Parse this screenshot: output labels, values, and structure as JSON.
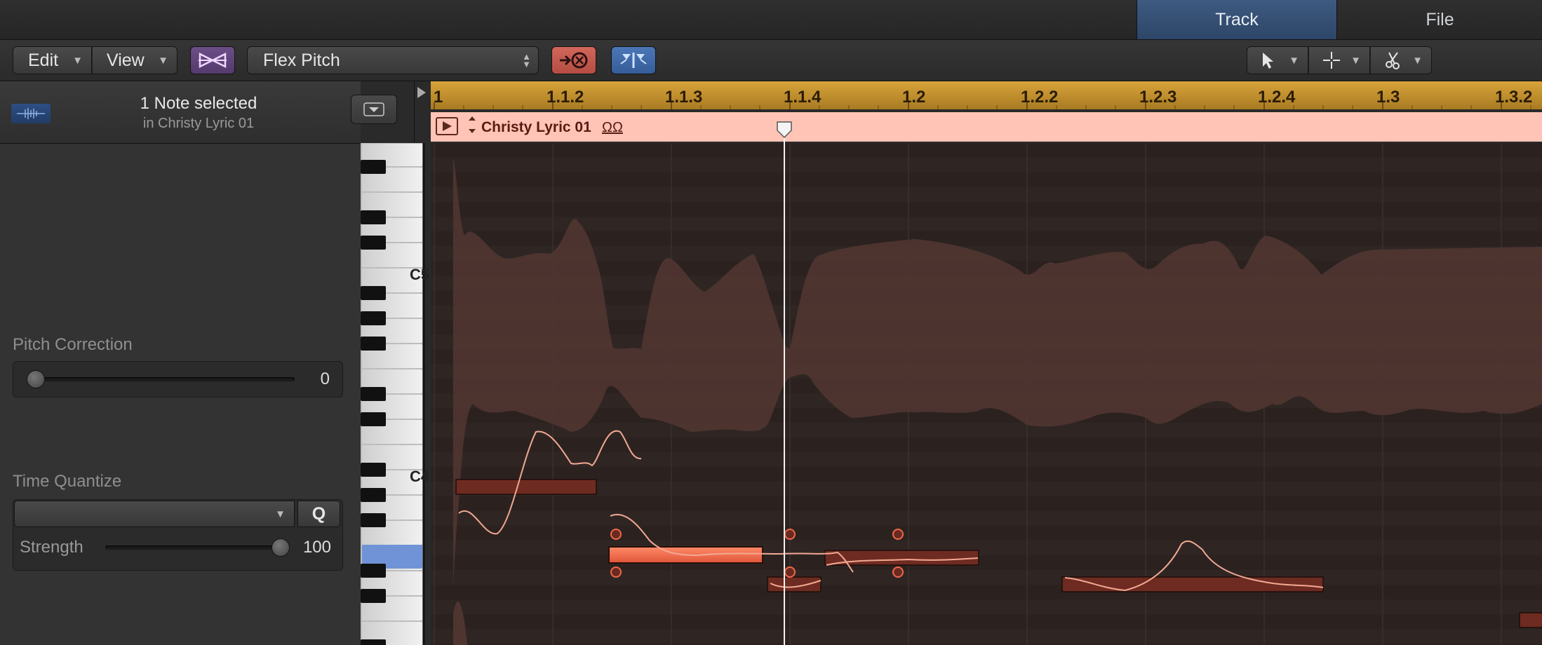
{
  "tabs": {
    "track": "Track",
    "file": "File"
  },
  "toolbar": {
    "edit": "Edit",
    "view": "View",
    "flex_mode": "Flex Pitch"
  },
  "inspector": {
    "selection_title": "1 Note selected",
    "selection_sub": "in Christy Lyric 01",
    "pitch_correction": {
      "label": "Pitch Correction",
      "value": "0"
    },
    "time_quantize": {
      "label": "Time Quantize",
      "selected": "",
      "q_button": "Q"
    },
    "strength": {
      "label": "Strength",
      "value": "100",
      "level": 1.0
    }
  },
  "keyboard": {
    "labels": [
      "C5",
      "C4"
    ]
  },
  "ruler": {
    "marks": [
      "1",
      "1.1.2",
      "1.1.3",
      "1.1.4",
      "1.2",
      "1.2.2",
      "1.2.3",
      "1.2.4",
      "1.3",
      "1.3.2"
    ]
  },
  "region": {
    "name": "Christy Lyric 01",
    "loop_glyph": "ΩΩ"
  },
  "colors": {
    "ruler": "#c4962e",
    "region_header": "#ffc4b6",
    "note": "#6e2b21",
    "note_selected": "#f0684a",
    "waveform": "#4f3530",
    "editor_bg": "#2f2624",
    "tab_active": "#3b5679"
  },
  "icons": {
    "flex": "flex-icon",
    "catch": "catch-icon",
    "follow": "follow-icon",
    "pointer": "pointer-tool-icon",
    "marquee": "marquee-tool-icon",
    "scissors": "scissors-tool-icon"
  }
}
